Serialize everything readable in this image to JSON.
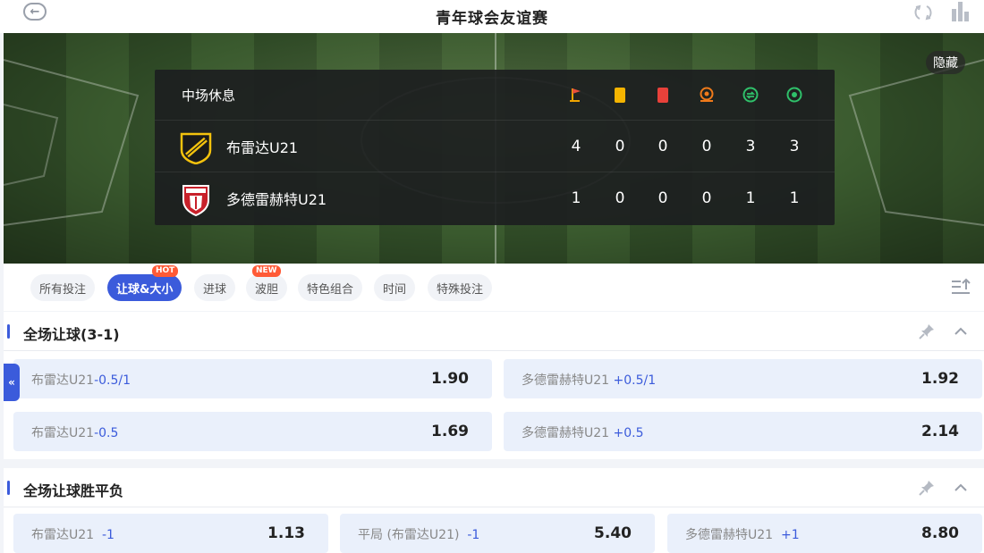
{
  "header": {
    "title": "青年球会友谊赛"
  },
  "banner": {
    "hide_label": "隐藏"
  },
  "scoreboard": {
    "status": "中场休息",
    "stat_icons": [
      "corner-flag-icon",
      "yellow-card-icon",
      "red-card-icon",
      "penalty-icon",
      "substitution-icon",
      "goal-icon"
    ],
    "teams": [
      {
        "name": "布雷达U21",
        "stats": [
          "4",
          "0",
          "0",
          "0",
          "3",
          "3"
        ]
      },
      {
        "name": "多德雷赫特U21",
        "stats": [
          "1",
          "0",
          "0",
          "0",
          "1",
          "1"
        ]
      }
    ]
  },
  "tabs": [
    {
      "label": "所有投注",
      "tag": ""
    },
    {
      "label": "让球&大小",
      "tag": "HOT",
      "active": true
    },
    {
      "label": "进球",
      "tag": ""
    },
    {
      "label": "波胆",
      "tag": "NEW"
    },
    {
      "label": "特色组合",
      "tag": ""
    },
    {
      "label": "时间",
      "tag": ""
    },
    {
      "label": "特殊投注",
      "tag": ""
    }
  ],
  "side_toggle": "«",
  "sections": [
    {
      "title": "全场让球(3-1)",
      "rows": [
        [
          {
            "team": "布雷达U21",
            "line": "-0.5/1",
            "odds": "1.90"
          },
          {
            "team": "多德雷赫特U21",
            "line": "+0.5/1",
            "odds": "1.92"
          }
        ],
        [
          {
            "team": "布雷达U21",
            "line": "-0.5",
            "odds": "1.69"
          },
          {
            "team": "多德雷赫特U21",
            "line": "+0.5",
            "odds": "2.14"
          }
        ]
      ]
    },
    {
      "title": "全场让球胜平负",
      "rows": [
        [
          {
            "team": "布雷达U21",
            "line": "-1",
            "odds": "1.13"
          },
          {
            "team": "平局 (布雷达U21)",
            "line": "-1",
            "odds": "5.40"
          },
          {
            "team": "多德雷赫特U21",
            "line": "+1",
            "odds": "8.80"
          }
        ]
      ]
    }
  ]
}
